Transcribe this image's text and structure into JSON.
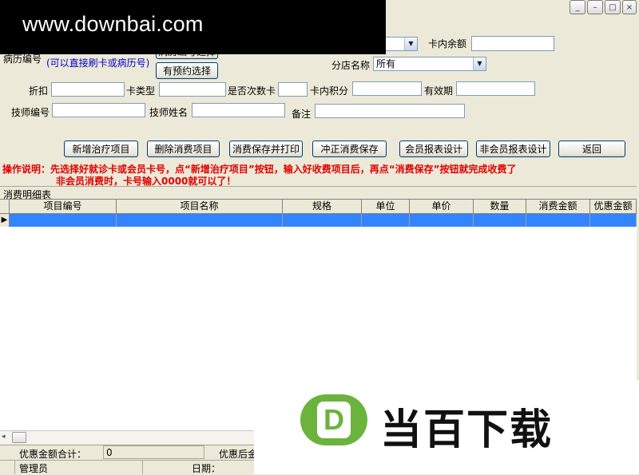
{
  "watermark": {
    "text": "www.downbai.com"
  },
  "window": {
    "title": "",
    "controls": [
      "_",
      "□",
      "×"
    ]
  },
  "form": {
    "card_balance_label": "卡内余额",
    "card_balance_value": "",
    "medical_record_label": "病历编号",
    "hint": "(可以直接刷卡或病历号)",
    "select_medical_record_button": "病历编号选择",
    "appointment_button": "有预约选择",
    "branch_label": "分店名称",
    "branch_value": "所有",
    "discount_label": "折扣",
    "discount_value": "",
    "card_type_label": "卡类型",
    "card_type_value": "",
    "times_card_label": "是否次数卡",
    "times_card_value": "",
    "points_label": "卡内积分",
    "points_value": "",
    "validity_label": "有效期",
    "validity_value": "",
    "tech_no_label": "技师编号",
    "tech_no_value": "",
    "tech_name_label": "技师姓名",
    "tech_name_value": "",
    "remark_label": "备注",
    "remark_value": ""
  },
  "toolbar": {
    "add_item": "新增治疗项目",
    "delete_item": "删除消费项目",
    "save_print": "消费保存并打印",
    "reverse_save": "冲正消费保存",
    "member_report": "会员报表设计",
    "nonmember_report": "非会员报表设计",
    "back": "返回"
  },
  "instructions": {
    "line1": "操作说明：先选择好就诊卡或会员卡号，点“新增治疗项目”按钮，输入好收费项目后，再点“消费保存”按钮就完成收费了",
    "line2": "非会员消费时，卡号输入0000就可以了！"
  },
  "detail": {
    "section_label": "消费明细表",
    "row_indicator": "▶",
    "columns": [
      "项目编号",
      "项目名称",
      "规格",
      "单位",
      "单价",
      "数量",
      "消费金额",
      "优惠金额"
    ]
  },
  "footer": {
    "discount_total_label": "优惠金额合计：",
    "discount_total_value": "0",
    "after_discount_label": "优惠后金",
    "user": "管理员",
    "date_label": "日期："
  },
  "brand": {
    "text": "当百下载",
    "letter": "D",
    "color": "#6cb33e"
  }
}
